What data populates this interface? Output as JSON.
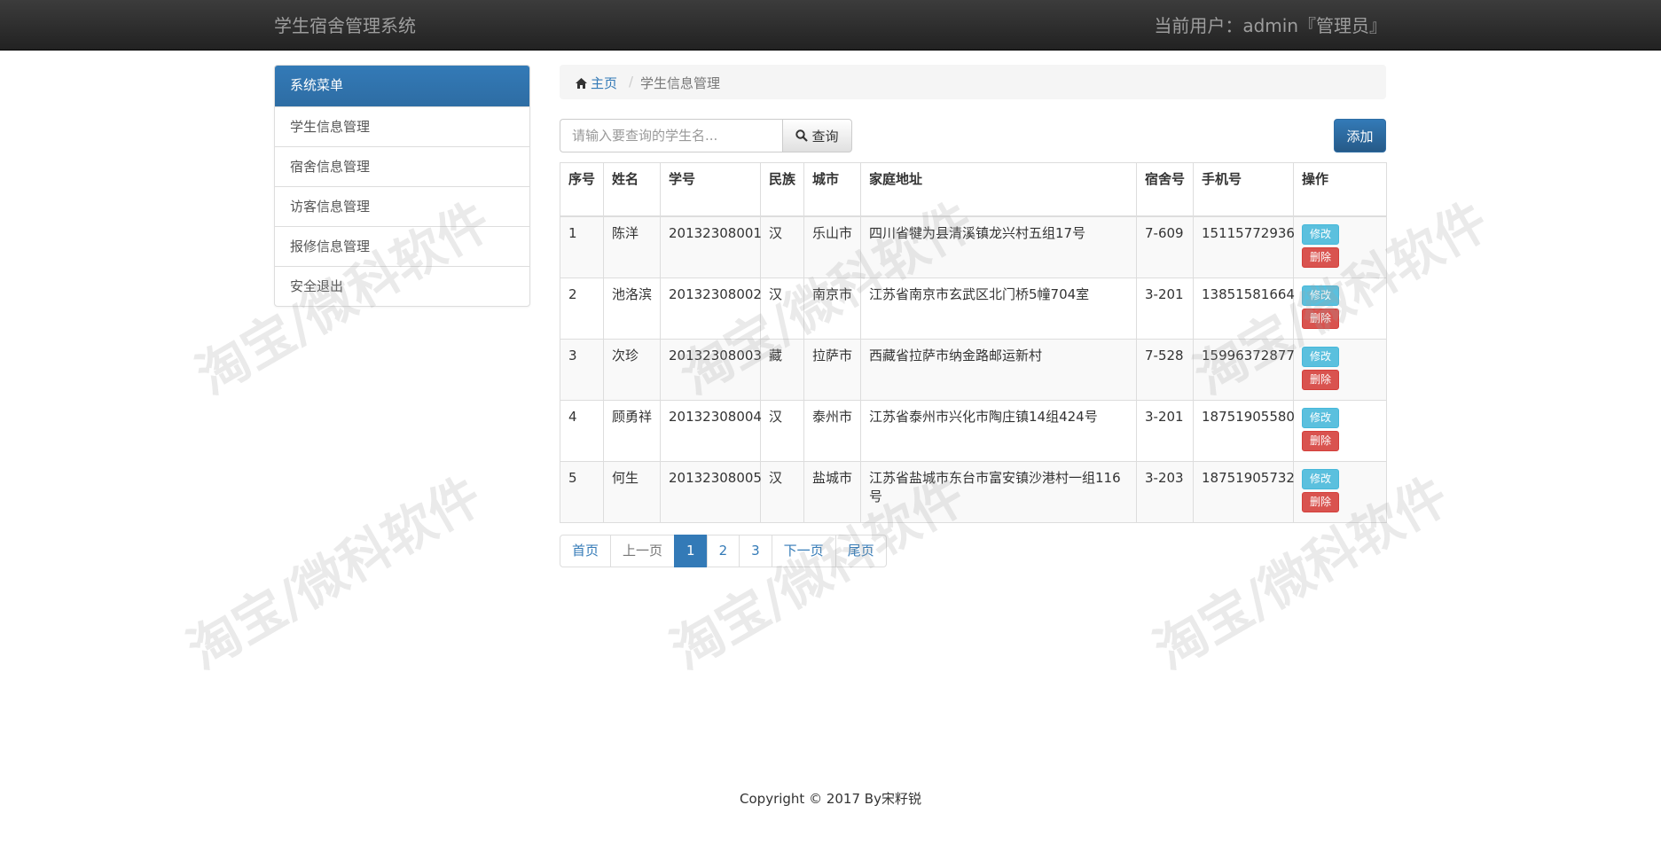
{
  "header": {
    "brand": "学生宿舍管理系统",
    "current_user": "当前用户：admin『管理员』"
  },
  "sidebar": {
    "heading": "系统菜单",
    "items": [
      {
        "label": "学生信息管理"
      },
      {
        "label": "宿舍信息管理"
      },
      {
        "label": "访客信息管理"
      },
      {
        "label": "报修信息管理"
      },
      {
        "label": "安全退出"
      }
    ]
  },
  "breadcrumb": {
    "home": "主页",
    "separator": "/",
    "current": "学生信息管理"
  },
  "search": {
    "placeholder": "请输入要查询的学生名...",
    "button_label": "查询"
  },
  "add_button": "添加",
  "table": {
    "headers": [
      "序号",
      "姓名",
      "学号",
      "民族",
      "城市",
      "家庭地址",
      "宿舍号",
      "手机号",
      "操作"
    ],
    "rows": [
      {
        "index": "1",
        "name": "陈洋",
        "student_id": "20132308001",
        "ethnicity": "汉",
        "city": "乐山市",
        "address": "四川省犍为县清溪镇龙兴村五组17号",
        "dorm": "7-609",
        "phone": "15115772936"
      },
      {
        "index": "2",
        "name": "池洛滨",
        "student_id": "20132308002",
        "ethnicity": "汉",
        "city": "南京市",
        "address": "江苏省南京市玄武区北门桥5幢704室",
        "dorm": "3-201",
        "phone": "13851581664"
      },
      {
        "index": "3",
        "name": "次珍",
        "student_id": "20132308003",
        "ethnicity": "藏",
        "city": "拉萨市",
        "address": "西藏省拉萨市纳金路邮运新村",
        "dorm": "7-528",
        "phone": "15996372877"
      },
      {
        "index": "4",
        "name": "顾勇祥",
        "student_id": "20132308004",
        "ethnicity": "汉",
        "city": "泰州市",
        "address": "江苏省泰州市兴化市陶庄镇14组424号",
        "dorm": "3-201",
        "phone": "18751905580"
      },
      {
        "index": "5",
        "name": "何生",
        "student_id": "20132308005",
        "ethnicity": "汉",
        "city": "盐城市",
        "address": "江苏省盐城市东台市富安镇沙港村一组116号",
        "dorm": "3-203",
        "phone": "18751905732"
      }
    ],
    "edit_label": "修改",
    "delete_label": "删除"
  },
  "pagination": {
    "first": "首页",
    "prev": "上一页",
    "pages": [
      "1",
      "2",
      "3"
    ],
    "active_page": "1",
    "next": "下一页",
    "last": "尾页"
  },
  "footer": "Copyright © 2017 By宋籽锐",
  "watermark": "淘宝/微科软件",
  "colors": {
    "primary": "#337ab7",
    "info": "#5bc0de",
    "danger": "#d9534f",
    "navbar": "#2b2b2b"
  }
}
